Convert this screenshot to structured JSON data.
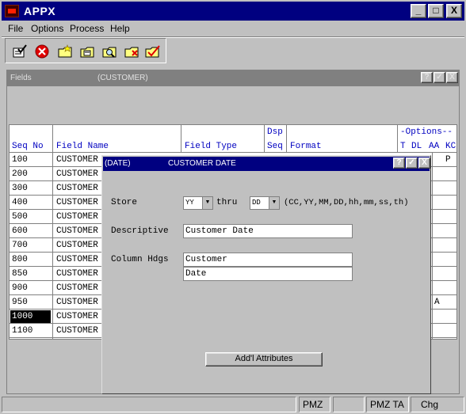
{
  "app": {
    "title": "APPX"
  },
  "window_controls": {
    "minimize": "_",
    "maximize": "□",
    "close": "X"
  },
  "menu": [
    "File",
    "Options",
    "Process",
    "Help"
  ],
  "toolbar": {
    "icons": [
      "checklist-icon",
      "cancel-icon",
      "folder-add-icon",
      "folder-edit-icon",
      "folder-search-icon",
      "folder-delete-icon",
      "folder-check-icon"
    ]
  },
  "fields_window": {
    "title": "Fields",
    "subtitle": "(CUSTOMER)",
    "buttons": [
      "?",
      "✓",
      "X"
    ],
    "headers": {
      "seq_no": "Seq No",
      "field_name": "Field Name",
      "field_type": "Field Type",
      "dsp": "Dsp",
      "seq": "Seq",
      "format": "Format",
      "options": "-Options--",
      "t": "T",
      "dl": "DL",
      "aa": "AA",
      "kc": "KC"
    },
    "rows": [
      {
        "seq": "100",
        "name": "CUSTOMER",
        "right": "P"
      },
      {
        "seq": "200",
        "name": "CUSTOMER",
        "right": ""
      },
      {
        "seq": "300",
        "name": "CUSTOMER",
        "right": ""
      },
      {
        "seq": "400",
        "name": "CUSTOMER",
        "right": ""
      },
      {
        "seq": "500",
        "name": "CUSTOMER",
        "right": ""
      },
      {
        "seq": "600",
        "name": "CUSTOMER",
        "right": ""
      },
      {
        "seq": "700",
        "name": "CUSTOMER",
        "right": ""
      },
      {
        "seq": "800",
        "name": "CUSTOMER",
        "right": ""
      },
      {
        "seq": "850",
        "name": "CUSTOMER",
        "right": ""
      },
      {
        "seq": "900",
        "name": "CUSTOMER",
        "right": ""
      },
      {
        "seq": "950",
        "name": "CUSTOMER",
        "right": "A"
      },
      {
        "seq": "1000",
        "name": "CUSTOMER",
        "right": ""
      },
      {
        "seq": "1100",
        "name": "CUSTOMER",
        "right": ""
      }
    ]
  },
  "dialog": {
    "title_left": "(DATE)",
    "title": "CUSTOMER DATE",
    "buttons": [
      "?",
      "✓",
      "X"
    ],
    "store_label": "Store",
    "store_from": "YY",
    "thru_label": "thru",
    "store_to": "DD",
    "store_hint": "(CC,YY,MM,DD,hh,mm,ss,th)",
    "descriptive_label": "Descriptive",
    "descriptive_value": "Customer Date",
    "column_hdgs_label": "Column Hdgs",
    "column_hdg_1": "Customer",
    "column_hdg_2": "Date",
    "addl_button": "Add'l Attributes"
  },
  "status": {
    "p1": "PMZ",
    "p2": "PMZ TA",
    "p3": "Chg"
  }
}
